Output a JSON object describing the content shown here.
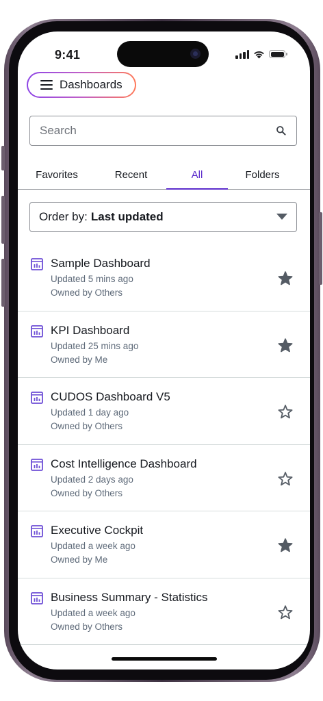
{
  "status_bar": {
    "time": "9:41"
  },
  "header": {
    "menu_label": "Dashboards"
  },
  "search": {
    "placeholder": "Search"
  },
  "tabs": [
    {
      "label": "Favorites",
      "active": false
    },
    {
      "label": "Recent",
      "active": false
    },
    {
      "label": "All",
      "active": true
    },
    {
      "label": "Folders",
      "active": false
    }
  ],
  "order_by": {
    "label": "Order by:",
    "value": "Last updated"
  },
  "dashboards": [
    {
      "title": "Sample Dashboard",
      "updated": "Updated 5 mins ago",
      "owner": "Owned by Others",
      "favorite": true
    },
    {
      "title": "KPI Dashboard",
      "updated": "Updated 25 mins ago",
      "owner": "Owned by Me",
      "favorite": true
    },
    {
      "title": "CUDOS Dashboard V5",
      "updated": "Updated 1 day ago",
      "owner": "Owned by Others",
      "favorite": false
    },
    {
      "title": "Cost Intelligence Dashboard",
      "updated": "Updated 2 days ago",
      "owner": "Owned by Others",
      "favorite": false
    },
    {
      "title": "Executive Cockpit",
      "updated": "Updated a week ago",
      "owner": "Owned by Me",
      "favorite": true
    },
    {
      "title": "Business Summary - Statistics",
      "updated": "Updated a week ago",
      "owner": "Owned by Others",
      "favorite": false
    }
  ],
  "colors": {
    "accent": "#5b2bcc",
    "dashboard_icon": "#6e4fd6",
    "star_filled": "#545b64"
  }
}
